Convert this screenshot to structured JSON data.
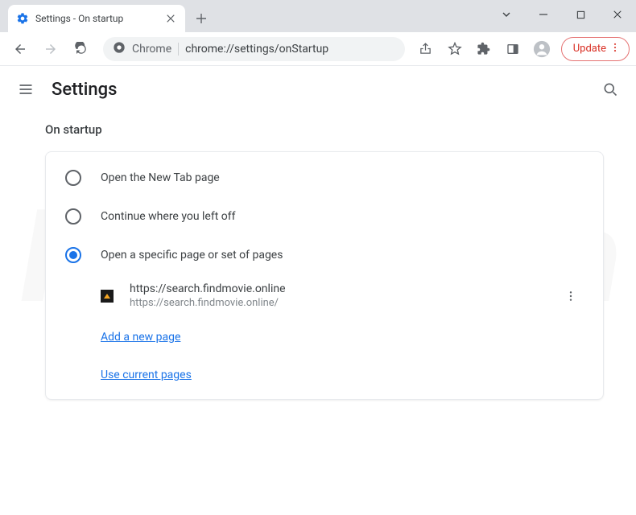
{
  "tab": {
    "title": "Settings - On startup"
  },
  "omnibox": {
    "prefix": "Chrome",
    "url": "chrome://settings/onStartup"
  },
  "toolbar": {
    "update": "Update"
  },
  "header": {
    "title": "Settings"
  },
  "section": {
    "title": "On startup"
  },
  "radios": [
    {
      "label": "Open the New Tab page",
      "selected": false
    },
    {
      "label": "Continue where you left off",
      "selected": false
    },
    {
      "label": "Open a specific page or set of pages",
      "selected": true
    }
  ],
  "page_entry": {
    "title": "https://search.findmovie.online",
    "url": "https://search.findmovie.online/"
  },
  "links": {
    "add": "Add a new page",
    "use_current": "Use current pages"
  }
}
